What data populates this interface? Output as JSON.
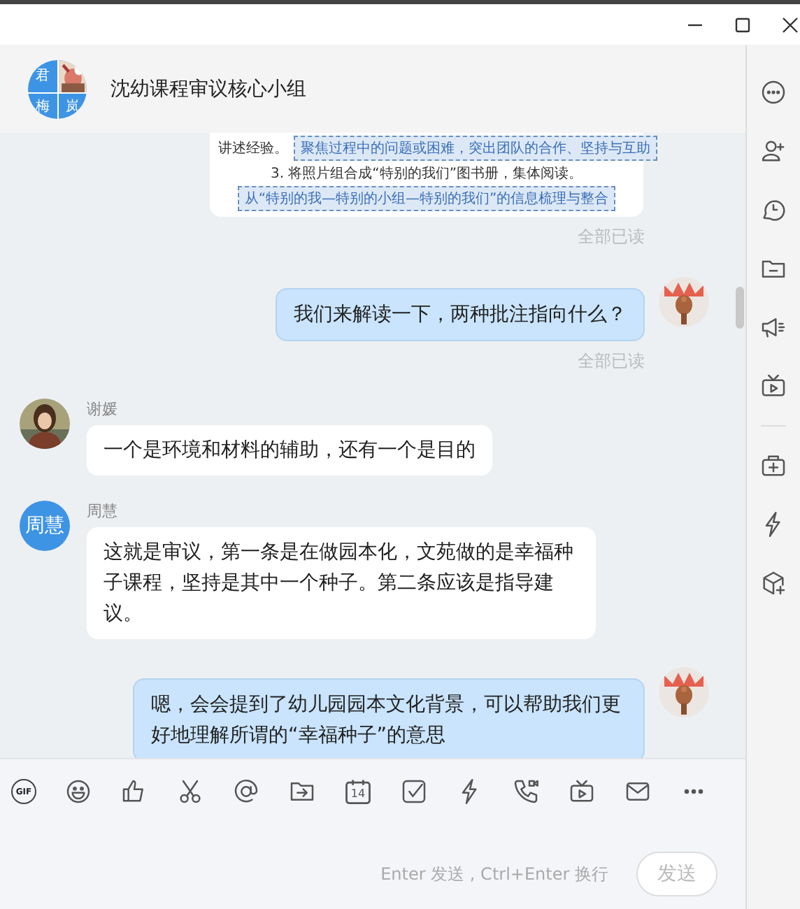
{
  "chat": {
    "title": "沈幼课程审议核心小组",
    "avatar_labels": [
      "君",
      "梅",
      "岚"
    ]
  },
  "messages": [
    {
      "kind": "document",
      "rows": [
        {
          "text": "讲述经验。",
          "note": "聚焦过程中的问题或困难，突出团队的合作、坚持与互助"
        },
        {
          "text": "3. 将照片组合成“特别的我们”图书册，集体阅读。"
        },
        {
          "note": "从“特别的我—特别的小组—特别的我们”的信息梳理与整合"
        }
      ]
    },
    {
      "kind": "receipt",
      "text": "全部已读"
    },
    {
      "kind": "mine",
      "text": "我们来解读一下，两种批注指向什么？"
    },
    {
      "kind": "receipt",
      "text": "全部已读"
    },
    {
      "kind": "other",
      "sender": "谢媛",
      "text": "一个是环境和材料的辅助，还有一个是目的"
    },
    {
      "kind": "other",
      "sender": "周慧",
      "avatar": {
        "kind": "text",
        "label": "周慧"
      },
      "text": "这就是审议，第一条是在做园本化，文苑做的是幸福种子课程，坚持是其中一个种子。第二条应该是指导建议。"
    },
    {
      "kind": "mine",
      "text": "嗯，会会提到了幼儿园园本文化背景，可以帮助我们更好地理解所谓的“幸福种子”的意思"
    }
  ],
  "toolbar": {
    "gif_label": "GIF",
    "calendar_day": "14"
  },
  "composer": {
    "hint": "Enter 发送 , Ctrl+Enter 换行",
    "send": {
      "label": "发送",
      "disabled": true
    }
  }
}
